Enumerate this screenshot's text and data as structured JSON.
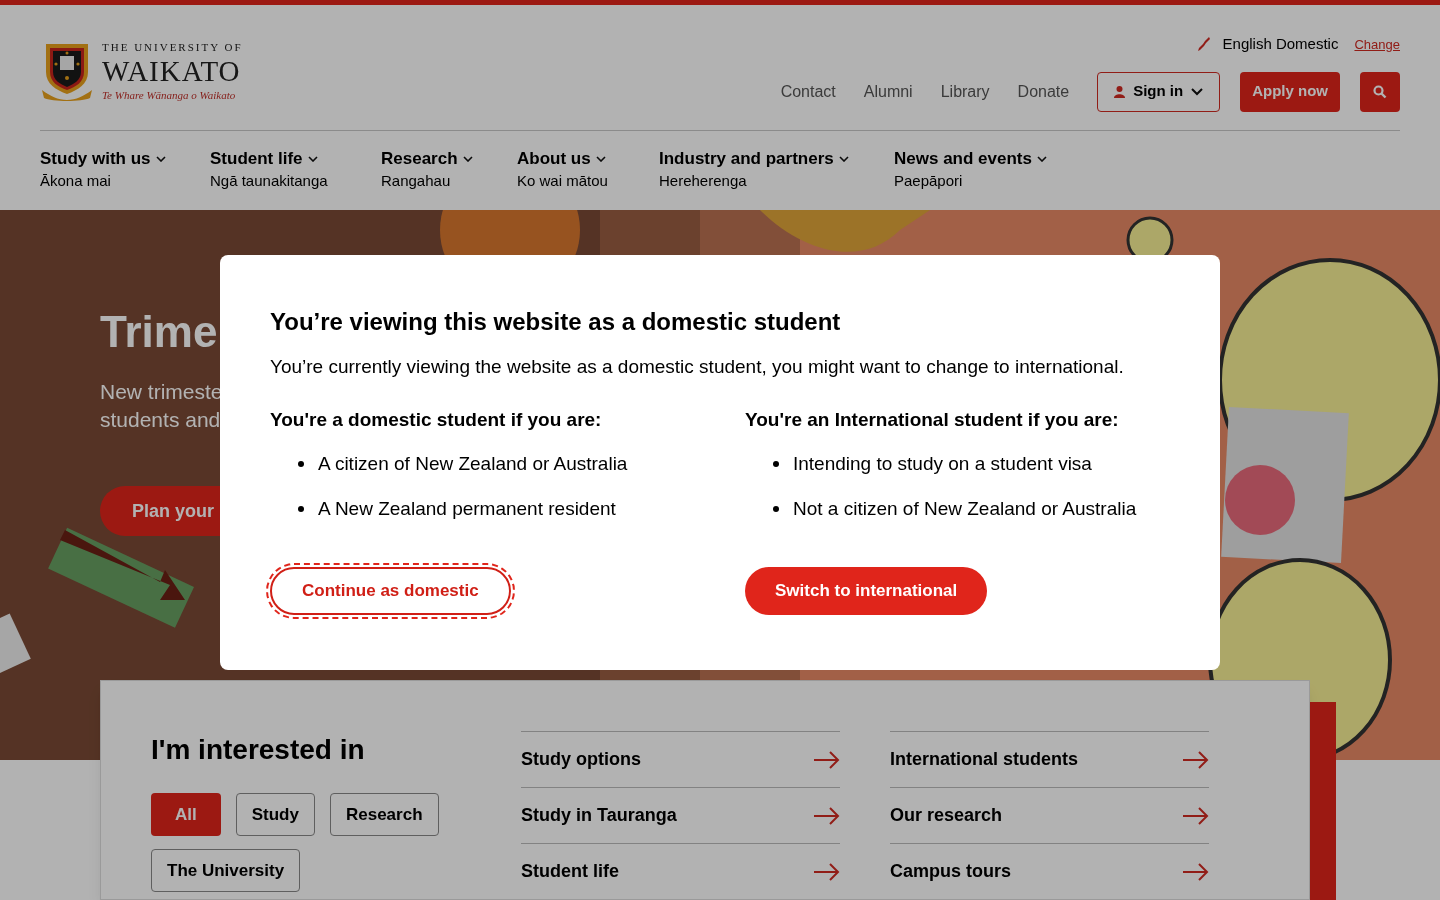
{
  "logo": {
    "line1": "THE UNIVERSITY OF",
    "line2": "WAIKATO",
    "line3": "Te Whare Wānanga o Waikato"
  },
  "region": {
    "label": "English Domestic",
    "change": "Change"
  },
  "utility_links": [
    "Contact",
    "Alumni",
    "Library",
    "Donate"
  ],
  "sign_in": "Sign in",
  "apply": "Apply now",
  "nav": [
    {
      "label": "Study with us",
      "sub": "Ākona mai"
    },
    {
      "label": "Student life",
      "sub": "Ngā taunakitanga"
    },
    {
      "label": "Research",
      "sub": "Rangahau"
    },
    {
      "label": "About us",
      "sub": "Ko wai mātou"
    },
    {
      "label": "Industry and partners",
      "sub": "Hereherenga"
    },
    {
      "label": "News and events",
      "sub": "Paepāpori"
    }
  ],
  "hero": {
    "title": "Trime",
    "subtitle": [
      "New trimeste",
      "students and"
    ],
    "button": "Plan your"
  },
  "modal": {
    "title": "You’re viewing this website as a domestic student",
    "intro": "You’re currently viewing the website as a domestic student, you might want to change to international.",
    "columns": [
      {
        "heading": "You're a domestic student if you are:",
        "items": [
          "A citizen of New Zealand or Australia",
          "A New Zealand permanent resident"
        ],
        "button": {
          "label": "Continue as domestic",
          "kind": "outline",
          "focused": true
        }
      },
      {
        "heading": "You're an International student if you are:",
        "items": [
          "Intending to study on a student visa",
          "Not a citizen of New Zealand or Australia"
        ],
        "button": {
          "label": "Switch to international",
          "kind": "solid",
          "focused": false
        }
      }
    ]
  },
  "interest": {
    "title": "I'm interested in",
    "filters": [
      {
        "label": "All",
        "selected": true
      },
      {
        "label": "Study",
        "selected": false
      },
      {
        "label": "Research",
        "selected": false
      },
      {
        "label": "The University",
        "selected": false
      }
    ],
    "links": [
      [
        "Study options",
        "Study in Tauranga",
        "Student life"
      ],
      [
        "International students",
        "Our research",
        "Campus tours"
      ]
    ]
  }
}
